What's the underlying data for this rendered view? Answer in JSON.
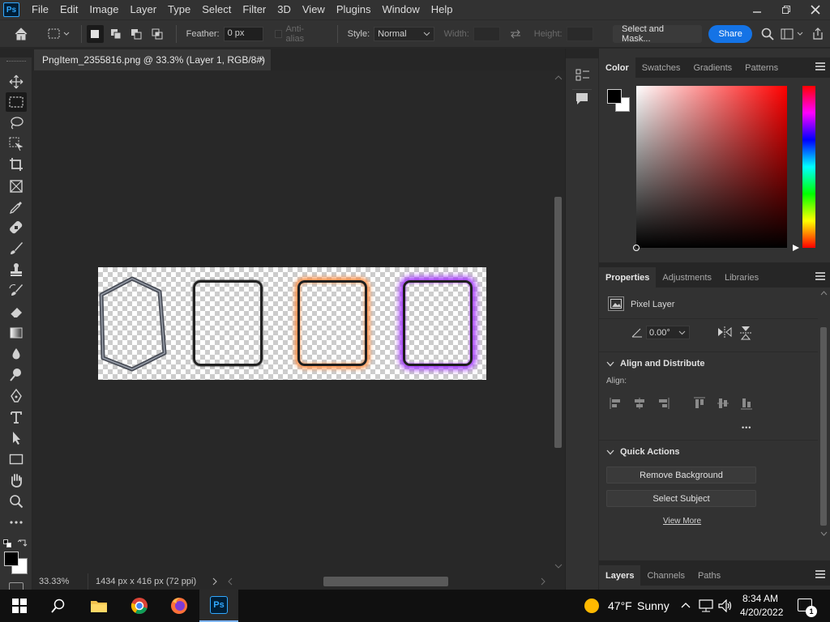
{
  "app": {
    "logo": "Ps"
  },
  "menubar": {
    "items": [
      "File",
      "Edit",
      "Image",
      "Layer",
      "Type",
      "Select",
      "Filter",
      "3D",
      "View",
      "Plugins",
      "Window",
      "Help"
    ],
    "window_controls": [
      "minimize-icon",
      "restore-icon",
      "close-icon"
    ]
  },
  "options_bar": {
    "feather_label": "Feather:",
    "feather_value": "0 px",
    "antialias_label": "Anti-alias",
    "style_label": "Style:",
    "style_value": "Normal",
    "width_label": "Width:",
    "height_label": "Height:",
    "select_and_mask": "Select and Mask...",
    "share": "Share"
  },
  "document": {
    "tab_title": "PngItem_2355816.png @ 33.3% (Layer 1, RGB/8#)",
    "close_glyph": "×",
    "frame_glow_colors": [
      "none",
      "none",
      "#ff8a3d",
      "#a030ff"
    ]
  },
  "status": {
    "zoom": "33.33%",
    "dimensions": "1434 px x 416 px (72 ppi)"
  },
  "color_panel": {
    "tabs": [
      "Color",
      "Swatches",
      "Gradients",
      "Patterns"
    ],
    "active_tab": "Color",
    "foreground": "#000000",
    "background": "#ffffff",
    "hue_color": "#ff0000"
  },
  "properties_panel": {
    "tabs": [
      "Properties",
      "Adjustments",
      "Libraries"
    ],
    "layer_type": "Pixel Layer",
    "angle_value": "0.00°",
    "align_section": "Align and Distribute",
    "align_label": "Align:",
    "more_glyph": "•••",
    "quick_actions_section": "Quick Actions",
    "remove_background": "Remove Background",
    "select_subject": "Select Subject",
    "view_more": "View More"
  },
  "layers_panel": {
    "tabs": [
      "Layers",
      "Channels",
      "Paths"
    ]
  },
  "taskbar": {
    "weather_temp": "47°F",
    "weather_desc": "Sunny",
    "time": "8:34 AM",
    "date": "4/20/2022",
    "notification_count": "1",
    "pinned": [
      "windows-start",
      "search",
      "file-explorer",
      "chrome",
      "firefox",
      "photoshop"
    ]
  }
}
